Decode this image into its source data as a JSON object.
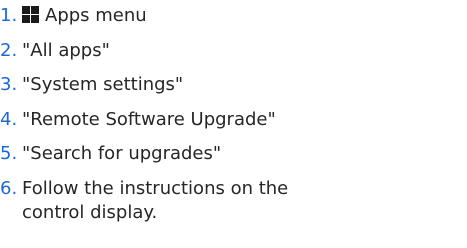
{
  "steps": [
    {
      "number": "1.",
      "icon": "apps-grid-icon",
      "text": "Apps menu"
    },
    {
      "number": "2.",
      "text": "\"All apps\""
    },
    {
      "number": "3.",
      "text": "\"System settings\""
    },
    {
      "number": "4.",
      "text": "\"Remote Software Upgrade\""
    },
    {
      "number": "5.",
      "text": "\"Search for upgrades\""
    },
    {
      "number": "6.",
      "text": "Follow the instructions on the control dis­play."
    }
  ],
  "colors": {
    "number": "#1c69d4",
    "text": "#262626"
  }
}
